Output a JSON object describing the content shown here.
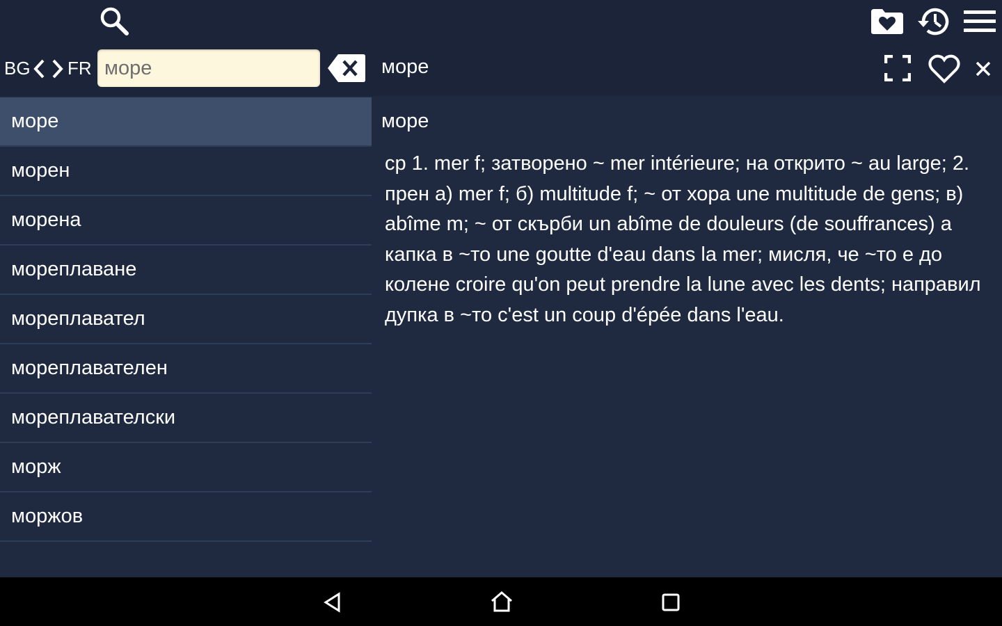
{
  "toolbar": {
    "icons": {
      "search": "search-icon",
      "favorites_folder": "favorites-folder-icon",
      "history": "history-icon",
      "menu": "menu-icon"
    },
    "lang_from": "BG",
    "lang_to": "FR",
    "search_value": "море",
    "current_word": "море"
  },
  "word_list": [
    "море",
    "морен",
    "морена",
    "мореплаване",
    "мореплавател",
    "мореплавателен",
    "мореплавателски",
    "морж",
    "моржов"
  ],
  "definition": {
    "title": "море",
    "text": "ср 1. mer f; затворено ~ mer intérieure; на открито ~ au large; 2. прен а) mer f; б) multitude f; ~ от хора une multitude de gens; в) abîme m; ~ от скърби un abîme de douleurs (de souffrances) а капка в ~то une goutte d'eau dans la mer; мисля, че ~то е до колене croire qu'on peut prendre la lune avec les dents; направил дупка в ~то c'est un coup d'épée dans l'eau."
  },
  "colors": {
    "toolbar_bg": "#1b2438",
    "content_bg": "#1f2a40",
    "selected_bg": "#3e4f6c",
    "search_bg": "#fdf7dd",
    "navbar_bg": "#000000"
  }
}
